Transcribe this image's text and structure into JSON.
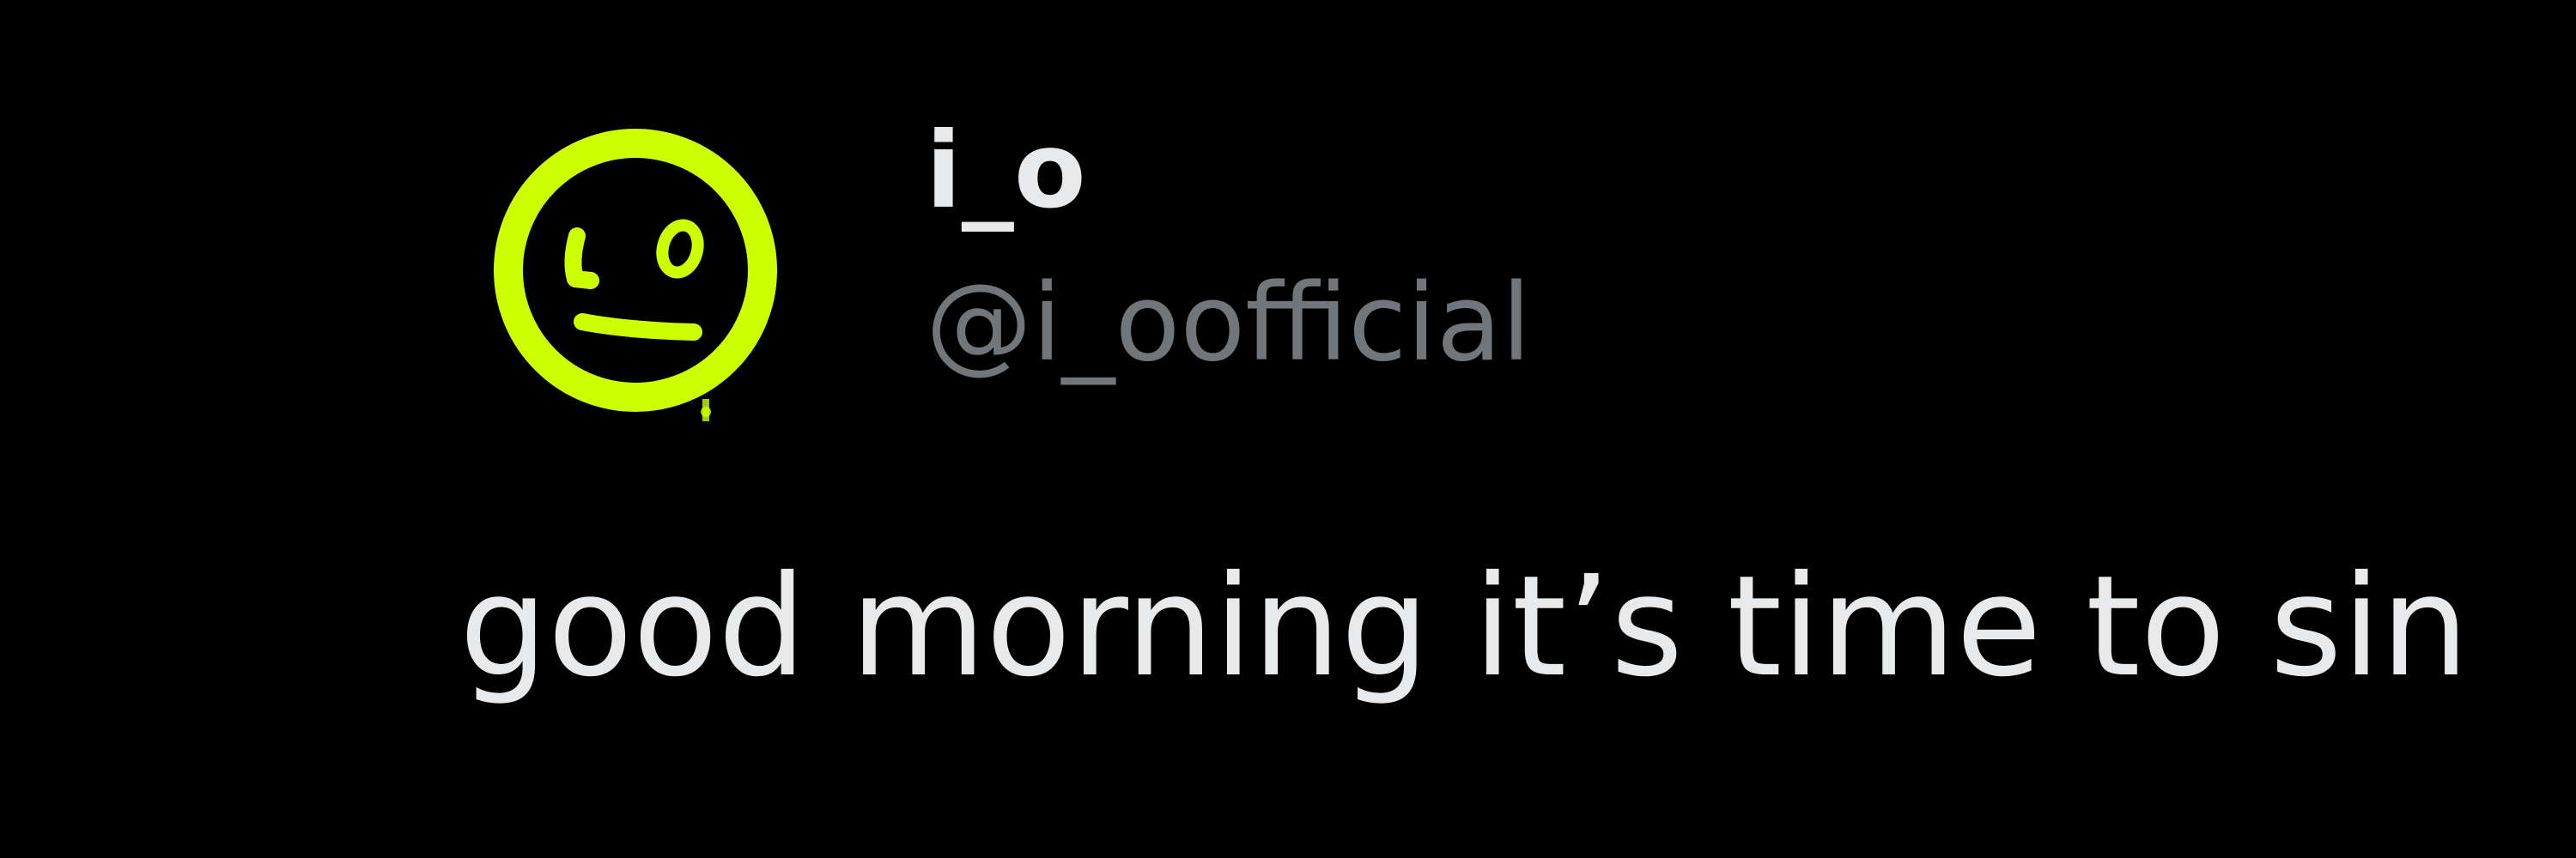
{
  "post": {
    "author": {
      "display_name": "i_o",
      "handle": "@i_oofficial",
      "avatar_icon": "neutral-face-graffiti-icon",
      "avatar_color": "#ccff00"
    },
    "text": "good morning it’s time to sin"
  },
  "theme": {
    "background": "#000000",
    "primary_text": "#e7e9ea",
    "secondary_text": "#71767b"
  }
}
